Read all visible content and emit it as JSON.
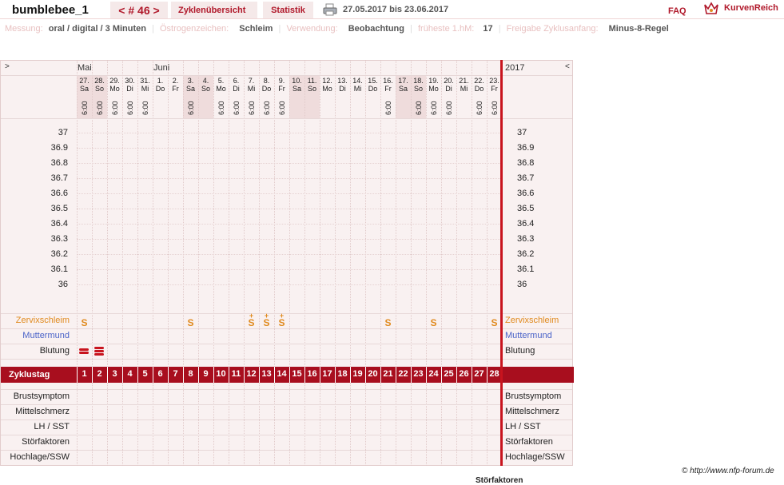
{
  "header": {
    "username": "bumblebee_1",
    "cycle_nav": "< # 46 >",
    "tab_overview": "Zyklenübersicht",
    "tab_stats": "Statistik",
    "date_range": "27.05.2017 bis 23.06.2017",
    "faq": "FAQ",
    "brand": "KurvenReich"
  },
  "meta": {
    "measure_label": "Messung:",
    "measure_value": "oral / digital / 3 Minuten",
    "estrogen_label": "Östrogenzeichen:",
    "estrogen_value": "Schleim",
    "use_label": "Verwendung:",
    "use_value": "Beobachtung",
    "earliest_label": "früheste 1.hM:",
    "earliest_value": "17",
    "release_label": "Freigabe Zyklusanfang:",
    "release_value": "Minus-8-Regel"
  },
  "chart": {
    "nav_left": ">",
    "nav_right": "<",
    "month_may": "Mai",
    "month_june": "Juni",
    "year": "2017",
    "rows": {
      "cervix": "Zervixschleim",
      "cervix_os": "Muttermund",
      "bleeding": "Blutung",
      "cycle_day": "Zyklustag",
      "breast": "Brustsymptom",
      "mittelschmerz": "Mittelschmerz",
      "lh": "LH / SST",
      "disturb": "Störfaktoren",
      "highlevel": "Hochlage/SSW"
    },
    "footer_copy": "© http://www.nfp-forum.de",
    "footer_cut": "Störfaktoren"
  },
  "colors": {
    "accent": "#b0182a",
    "cervix": "#e08a1e",
    "cervix_os": "#4a63c8",
    "grid_bg": "#f9f1f1",
    "weekend": "#efdcdc"
  },
  "chart_data": {
    "type": "line",
    "title": "",
    "ylabel": "",
    "ylim": [
      36,
      37
    ],
    "y_ticks": [
      "37",
      "36.9",
      "36.8",
      "36.7",
      "36.6",
      "36.5",
      "36.4",
      "36.3",
      "36.2",
      "36.1",
      "36"
    ],
    "dates": [
      "27.",
      "28.",
      "29.",
      "30.",
      "31.",
      "1.",
      "2.",
      "3.",
      "4.",
      "5.",
      "6.",
      "7.",
      "8.",
      "9.",
      "10.",
      "11.",
      "12.",
      "13.",
      "14.",
      "15.",
      "16.",
      "17.",
      "18.",
      "19.",
      "20.",
      "21.",
      "22.",
      "23."
    ],
    "weekdays": [
      "Sa",
      "So",
      "Mo",
      "Di",
      "Mi",
      "Do",
      "Fr",
      "Sa",
      "So",
      "Mo",
      "Di",
      "Mi",
      "Do",
      "Fr",
      "Sa",
      "So",
      "Mo",
      "Di",
      "Mi",
      "Do",
      "Fr",
      "Sa",
      "So",
      "Mo",
      "Di",
      "Mi",
      "Do",
      "Fr"
    ],
    "times": [
      "6:00",
      "6:00",
      "6:00",
      "6:00",
      "6:00",
      "",
      "",
      "6:00",
      "",
      "6:00",
      "6:00",
      "6:00",
      "6:00",
      "6:00",
      "",
      "",
      "",
      "",
      "",
      "",
      "6:00",
      "",
      "6:00",
      "6:00",
      "6:00",
      "",
      "6:00",
      "6:00"
    ],
    "cycle_days": [
      "1",
      "2",
      "3",
      "4",
      "5",
      "6",
      "7",
      "8",
      "9",
      "10",
      "11",
      "12",
      "13",
      "14",
      "15",
      "16",
      "17",
      "18",
      "19",
      "20",
      "21",
      "22",
      "23",
      "24",
      "25",
      "26",
      "27",
      "28"
    ],
    "cervix_marks": [
      "S",
      "",
      "",
      "",
      "",
      "",
      "",
      "S",
      "",
      "",
      "",
      "S+",
      "S+",
      "S+",
      "",
      "",
      "",
      "",
      "",
      "",
      "S",
      "",
      "",
      "S",
      "",
      "",
      "",
      "S"
    ],
    "bleeding_marks": [
      "2",
      "3",
      "",
      "",
      "",
      "",
      "",
      "",
      "",
      "",
      "",
      "",
      "",
      "",
      "",
      "",
      "",
      "",
      "",
      "",
      "",
      "",
      "",
      "",
      "",
      "",
      "",
      ""
    ],
    "temperatures": []
  }
}
